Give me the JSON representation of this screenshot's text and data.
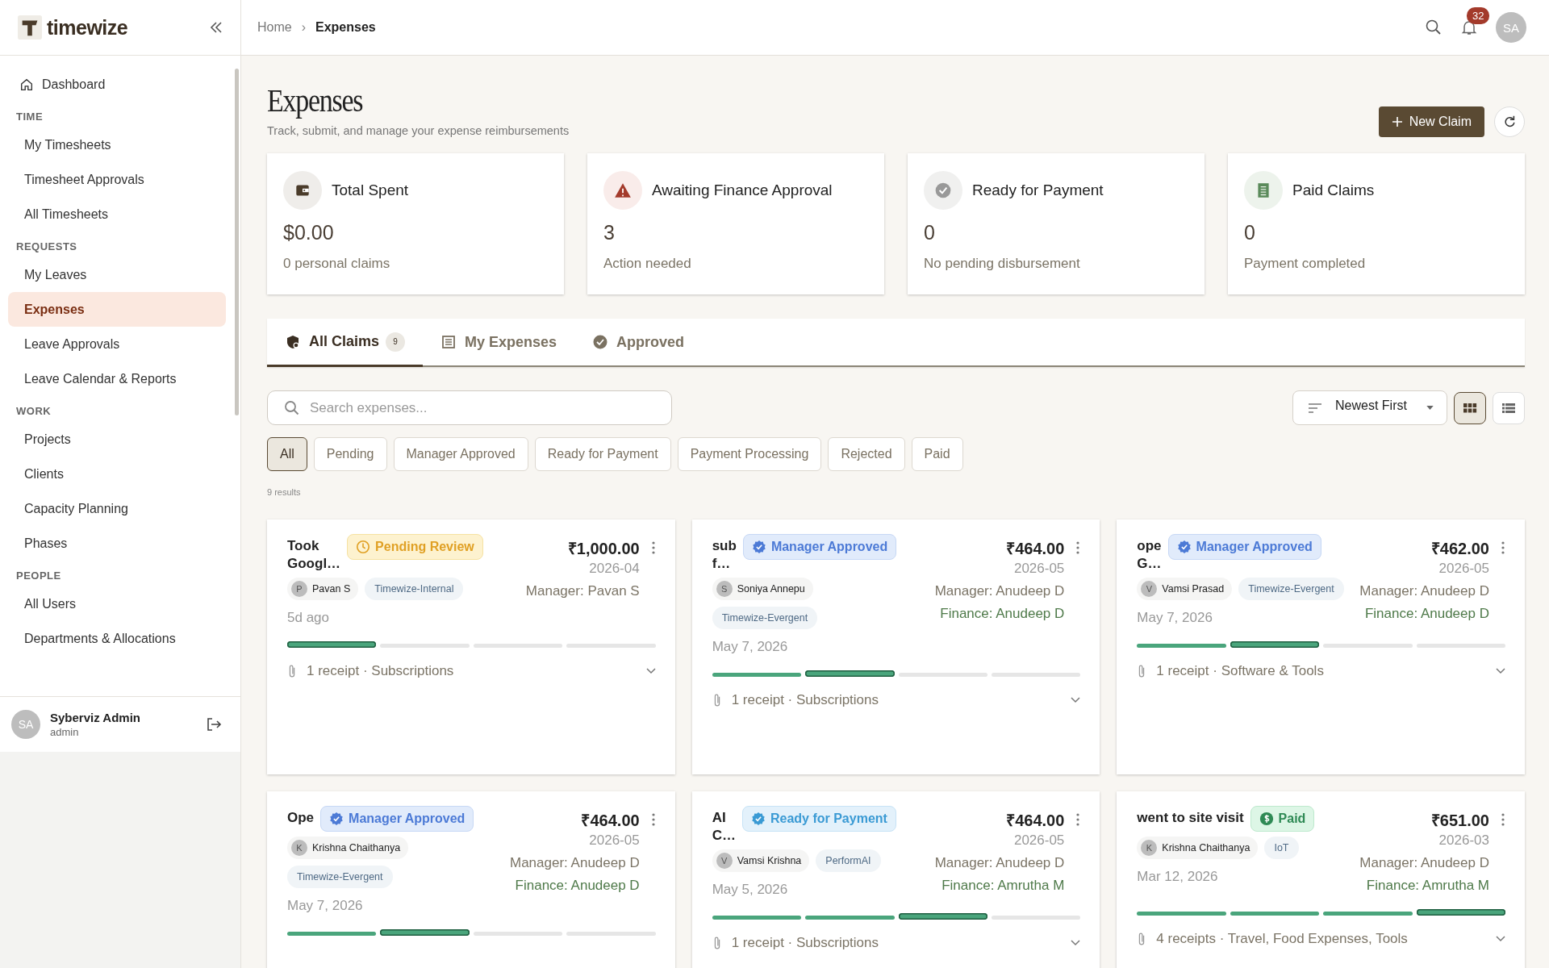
{
  "sidebar": {
    "logo": "timewize",
    "dashboard": {
      "label": "Dashboard",
      "selected": false
    },
    "sections": [
      {
        "heading": "TIME",
        "items": [
          {
            "label": "My Timesheets",
            "selected": false
          },
          {
            "label": "Timesheet Approvals",
            "selected": false
          },
          {
            "label": "All Timesheets",
            "selected": false
          }
        ]
      },
      {
        "heading": "REQUESTS",
        "items": [
          {
            "label": "My Leaves",
            "selected": false
          },
          {
            "label": "Expenses",
            "selected": true
          },
          {
            "label": "Leave Approvals",
            "selected": false
          },
          {
            "label": "Leave Calendar & Reports",
            "selected": false
          }
        ]
      },
      {
        "heading": "WORK",
        "items": [
          {
            "label": "Projects",
            "selected": false
          },
          {
            "label": "Clients",
            "selected": false
          },
          {
            "label": "Capacity Planning",
            "selected": false
          },
          {
            "label": "Phases",
            "selected": false
          }
        ]
      },
      {
        "heading": "PEOPLE",
        "items": [
          {
            "label": "All Users",
            "selected": false
          },
          {
            "label": "Departments & Allocations",
            "selected": false
          }
        ]
      }
    ],
    "user": {
      "initials": "SA",
      "name": "Syberviz Admin",
      "role": "admin"
    }
  },
  "header": {
    "breadcrumb": [
      "Home",
      "Expenses"
    ],
    "breadcrumb_separator": "›",
    "notification_count": "32",
    "avatar": "SA"
  },
  "page": {
    "title": "Expenses",
    "subtitle": "Track, submit, and manage your expense reimbursements",
    "new_button": "New Claim"
  },
  "stats": [
    {
      "kind": "wallet",
      "title": "Total Spent",
      "value": "$0.00",
      "note": "0 personal claims"
    },
    {
      "kind": "warning",
      "title": "Awaiting Finance Approval",
      "value": "3",
      "note": "Action needed"
    },
    {
      "kind": "check",
      "title": "Ready for Payment",
      "value": "0",
      "note": "No pending disbursement"
    },
    {
      "kind": "receipt",
      "title": "Paid Claims",
      "value": "0",
      "note": "Payment completed"
    }
  ],
  "tabs": [
    {
      "kind": "claims",
      "label": "All Claims",
      "count": "9",
      "selected": true
    },
    {
      "kind": "expenses",
      "label": "My Expenses",
      "selected": false
    },
    {
      "kind": "approved",
      "label": "Approved",
      "selected": false
    }
  ],
  "search": {
    "placeholder": "Search expenses..."
  },
  "sort": {
    "value": "Newest First"
  },
  "views": [
    {
      "kind": "grid",
      "selected": true
    },
    {
      "kind": "list",
      "selected": false
    }
  ],
  "filters": [
    {
      "label": "All",
      "selected": true
    },
    {
      "label": "Pending",
      "selected": false
    },
    {
      "label": "Manager Approved",
      "selected": false
    },
    {
      "label": "Ready for Payment",
      "selected": false
    },
    {
      "label": "Payment Processing",
      "selected": false
    },
    {
      "label": "Rejected",
      "selected": false
    },
    {
      "label": "Paid",
      "selected": false
    }
  ],
  "results": "9 results",
  "claims": [
    {
      "title": "Took\nGoogl…",
      "status": {
        "kind": "pending",
        "label": "Pending Review"
      },
      "amount": "₹1,000.00",
      "month": "2026-04",
      "person": {
        "initial": "P",
        "name": "Pavan S"
      },
      "project": "Timewize-Internal",
      "date": "5d ago",
      "manager": "Manager: Pavan S",
      "steps": [
        {
          "done": true,
          "current": true
        },
        {
          "done": false,
          "current": false
        },
        {
          "done": false,
          "current": false
        },
        {
          "done": false,
          "current": false
        }
      ],
      "receipts": "1 receipt · Subscriptions"
    },
    {
      "title": "sub\nf…",
      "status": {
        "kind": "manager",
        "label": "Manager Approved"
      },
      "amount": "₹464.00",
      "month": "2026-05",
      "person": {
        "initial": "S",
        "name": "Soniya Annepu"
      },
      "project": "Timewize-Evergent",
      "date": "May 7, 2026",
      "manager": "Manager: Anudeep D",
      "finance": "Finance: Anudeep D",
      "steps": [
        {
          "done": true,
          "current": false
        },
        {
          "done": true,
          "current": true
        },
        {
          "done": false,
          "current": false
        },
        {
          "done": false,
          "current": false
        }
      ],
      "receipts": "1 receipt · Subscriptions"
    },
    {
      "title": "ope\nG…",
      "status": {
        "kind": "manager",
        "label": "Manager Approved"
      },
      "amount": "₹462.00",
      "month": "2026-05",
      "person": {
        "initial": "V",
        "name": "Vamsi Prasad"
      },
      "project": "Timewize-Evergent",
      "date": "May 7, 2026",
      "manager": "Manager: Anudeep D",
      "finance": "Finance: Anudeep D",
      "steps": [
        {
          "done": true,
          "current": false
        },
        {
          "done": true,
          "current": true
        },
        {
          "done": false,
          "current": false
        },
        {
          "done": false,
          "current": false
        }
      ],
      "receipts": "1 receipt · Software & Tools"
    },
    {
      "title": "Ope",
      "status": {
        "kind": "manager",
        "label": "Manager Approved"
      },
      "amount": "₹464.00",
      "month": "2026-05",
      "person": {
        "initial": "K",
        "name": "Krishna Chaithanya"
      },
      "project": "Timewize-Evergent",
      "date": "May 7, 2026",
      "manager": "Manager: Anudeep D",
      "finance": "Finance: Anudeep D",
      "steps": [
        {
          "done": true,
          "current": false
        },
        {
          "done": true,
          "current": true
        },
        {
          "done": false,
          "current": false
        },
        {
          "done": false,
          "current": false
        }
      ]
    },
    {
      "title": "AI\nC…",
      "status": {
        "kind": "ready",
        "label": "Ready for Payment"
      },
      "amount": "₹464.00",
      "month": "2026-05",
      "person": {
        "initial": "V",
        "name": "Vamsi Krishna"
      },
      "project": "PerformAI",
      "date": "May 5, 2026",
      "manager": "Manager: Anudeep D",
      "finance": "Finance: Amrutha M",
      "steps": [
        {
          "done": true,
          "current": false
        },
        {
          "done": true,
          "current": false
        },
        {
          "done": true,
          "current": true
        },
        {
          "done": false,
          "current": false
        }
      ],
      "receipts": "1 receipt · Subscriptions"
    },
    {
      "title": "went to site visit",
      "status": {
        "kind": "paid",
        "label": "Paid"
      },
      "amount": "₹651.00",
      "month": "2026-03",
      "person": {
        "initial": "K",
        "name": "Krishna Chaithanya"
      },
      "project": "IoT",
      "date": "Mar 12, 2026",
      "manager": "Manager: Anudeep D",
      "finance": "Finance: Amrutha M",
      "steps": [
        {
          "done": true,
          "current": false
        },
        {
          "done": true,
          "current": false
        },
        {
          "done": true,
          "current": false
        },
        {
          "done": true,
          "current": true
        }
      ],
      "receipts": "4 receipts · Travel, Food Expenses, Tools"
    }
  ]
}
